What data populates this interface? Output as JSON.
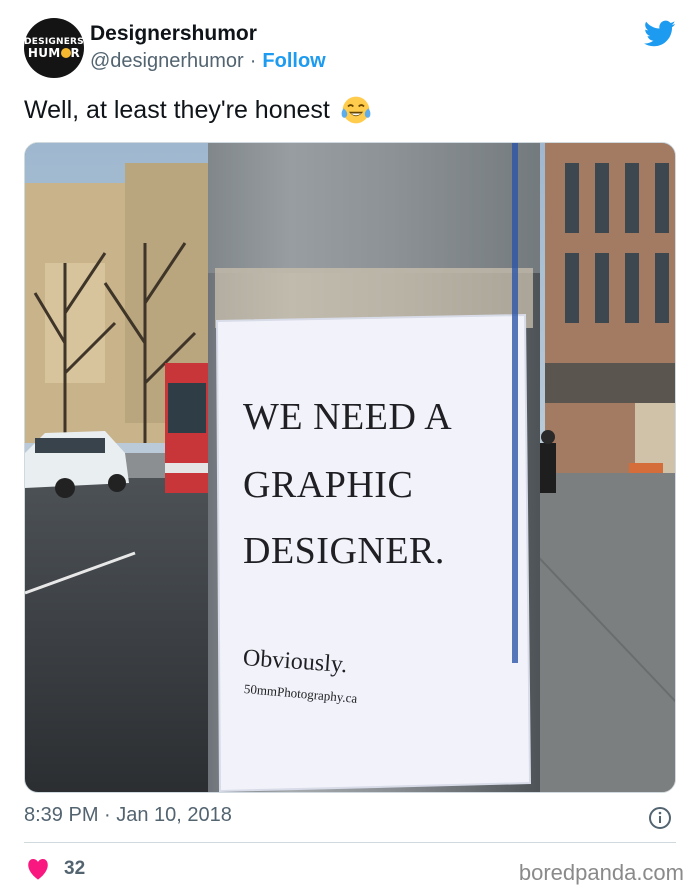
{
  "account": {
    "avatar_line1": "DESIGNERS",
    "avatar_line2_start": "HUM",
    "avatar_line2_end": "R",
    "display_name": "Designershumor",
    "handle": "@designerhumor",
    "separator": "·",
    "follow_label": "Follow"
  },
  "tweet": {
    "text": "Well, at least they're honest",
    "emoji": "face-with-tears-of-joy"
  },
  "photo": {
    "poster_line1": "WE NEED A",
    "poster_line2": "GRAPHIC",
    "poster_line3": "DESIGNER.",
    "poster_line4": "Obviously.",
    "poster_credit": "50mmPhotography.ca"
  },
  "meta": {
    "timestamp": "8:39 PM · Jan 10, 2018"
  },
  "engagement": {
    "like_count": "32"
  },
  "watermark": "boredpanda.com",
  "colors": {
    "twitter_blue": "#1d9bf0",
    "heart_red": "#f91880",
    "text_primary": "#0f1419",
    "text_secondary": "#536471"
  },
  "icons": {
    "brand": "twitter-bird-icon",
    "info": "info-icon",
    "like": "heart-icon"
  }
}
